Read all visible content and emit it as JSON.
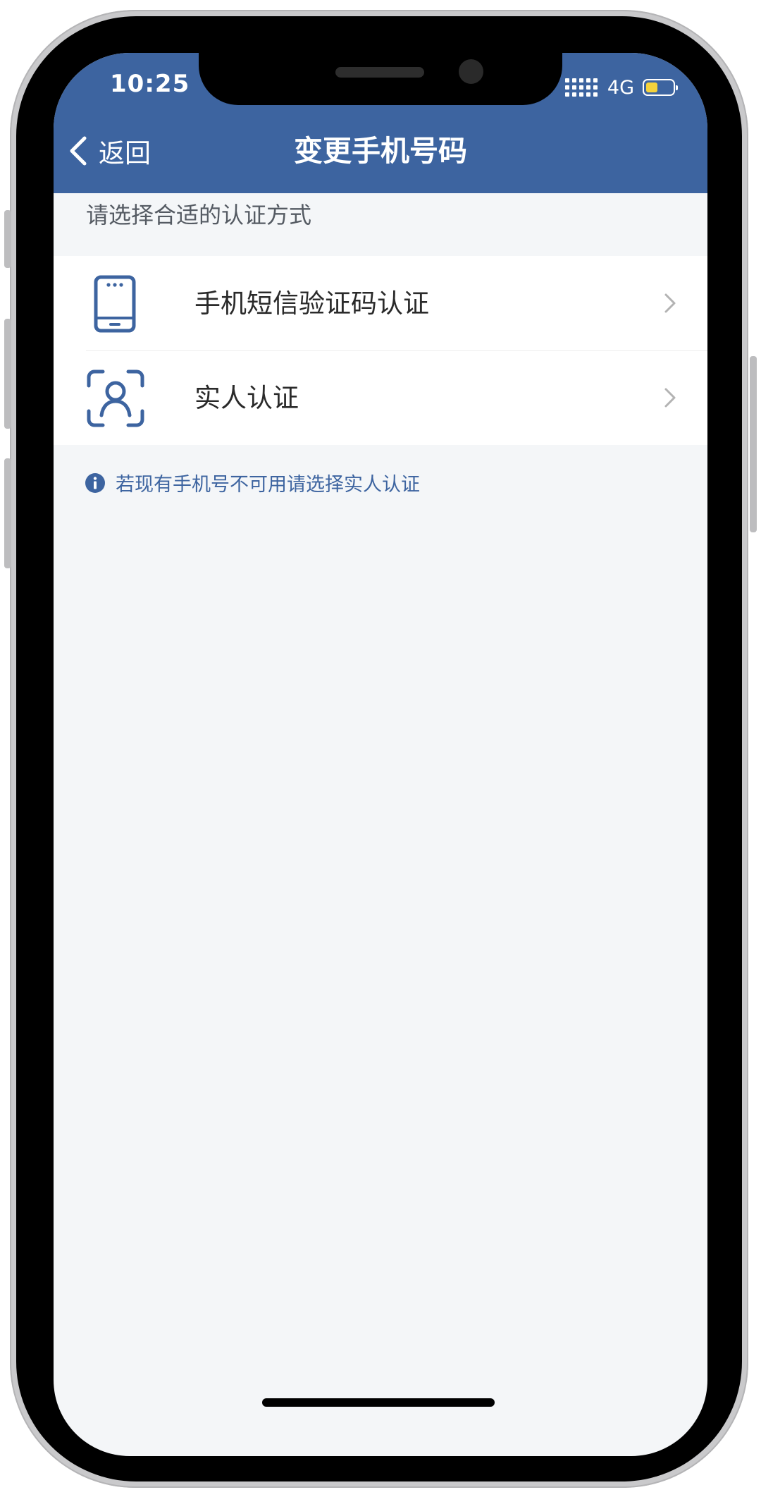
{
  "status_bar": {
    "time": "10:25",
    "network": "4G",
    "battery_level": 0.45
  },
  "nav": {
    "back_label": "返回",
    "title": "变更手机号码"
  },
  "section_label": "请选择合适的认证方式",
  "options": [
    {
      "label": "手机短信验证码认证",
      "icon": "smartphone-icon"
    },
    {
      "label": "实人认证",
      "icon": "face-scan-icon"
    }
  ],
  "tip": {
    "icon": "info-icon",
    "text": "若现有手机号不可用请选择实人认证"
  },
  "colors": {
    "header": "#3d64a0",
    "accent": "#3d64a0",
    "background": "#f4f6f8",
    "battery": "#f4d23c"
  }
}
